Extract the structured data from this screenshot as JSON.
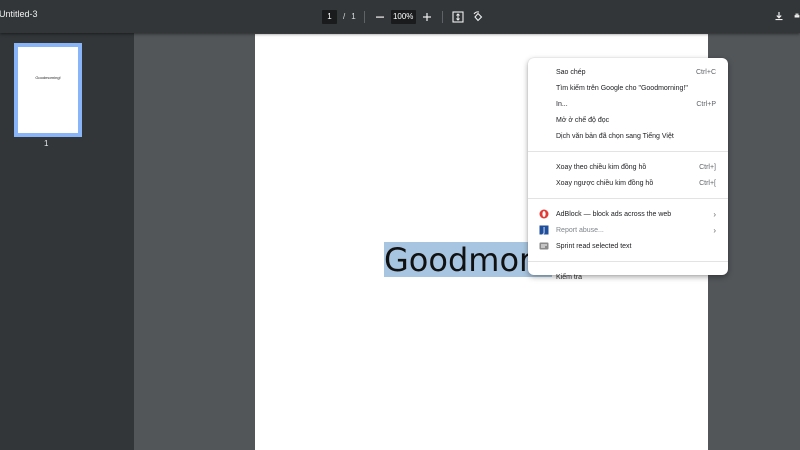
{
  "toolbar": {
    "title": "Untitled-3",
    "page_current": "1",
    "page_sep": "/",
    "page_total": "1",
    "zoom": "100%"
  },
  "sidebar": {
    "thumb_text": "Goodmorning!",
    "thumb_number": "1"
  },
  "page": {
    "selected_text": "Goodmorn"
  },
  "context_menu": {
    "group1": [
      {
        "label": "Sao chép",
        "shortcut": "Ctrl+C"
      },
      {
        "label": "Tìm kiếm trên Google cho \"Goodmorning!\"",
        "shortcut": ""
      },
      {
        "label": "In...",
        "shortcut": "Ctrl+P"
      },
      {
        "label": "Mở ở chế độ đọc",
        "shortcut": ""
      },
      {
        "label": "Dịch văn bản đã chọn sang Tiếng Việt",
        "shortcut": ""
      }
    ],
    "group2": [
      {
        "label": "Xoay theo chiều kim đồng hồ",
        "shortcut": "Ctrl+]"
      },
      {
        "label": "Xoay ngược chiều kim đồng hồ",
        "shortcut": "Ctrl+["
      }
    ],
    "group3": [
      {
        "label": "AdBlock — block ads across the web",
        "icon": "adblock-icon",
        "icon_color": "#e53935"
      },
      {
        "label": "Report abuse...",
        "icon": "report-j-icon",
        "icon_color": "#1f4e9c"
      },
      {
        "label": "Sprint read selected text",
        "icon": "sprint-reader-icon",
        "icon_color": "#8a8a8a"
      }
    ],
    "group4": [
      {
        "label": "Kiểm tra"
      }
    ]
  },
  "colors": {
    "toolbar_bg": "#323639",
    "viewer_bg": "#525659",
    "selection": "#a7c5e0",
    "thumb_border": "#8ab4f8"
  }
}
